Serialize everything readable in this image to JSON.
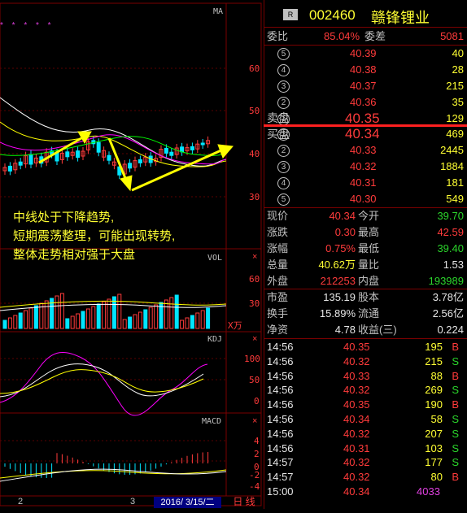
{
  "stock": {
    "badge": "R",
    "code": "002460",
    "name": "赣锋锂业"
  },
  "weibi": {
    "label_ratio": "委比",
    "ratio": "85.04%",
    "label_diff": "委差",
    "diff": "5081"
  },
  "sell_label": "卖盘",
  "buy_label": "买盘",
  "asks": [
    {
      "level": "5",
      "price": "40.39",
      "vol": "40"
    },
    {
      "level": "4",
      "price": "40.38",
      "vol": "28"
    },
    {
      "level": "3",
      "price": "40.37",
      "vol": "215"
    },
    {
      "level": "2",
      "price": "40.36",
      "vol": "35"
    },
    {
      "level": "1",
      "price": "40.35",
      "vol": "129"
    }
  ],
  "bids": [
    {
      "level": "1",
      "price": "40.34",
      "vol": "469"
    },
    {
      "level": "2",
      "price": "40.33",
      "vol": "2445"
    },
    {
      "level": "3",
      "price": "40.32",
      "vol": "1884"
    },
    {
      "level": "4",
      "price": "40.31",
      "vol": "181"
    },
    {
      "level": "5",
      "price": "40.30",
      "vol": "549"
    }
  ],
  "quote": [
    {
      "l1": "现价",
      "v1": "40.34",
      "l2": "今开",
      "v2": "39.70"
    },
    {
      "l1": "涨跌",
      "v1": "0.30",
      "l2": "最高",
      "v2": "42.59"
    },
    {
      "l1": "涨幅",
      "v1": "0.75%",
      "l2": "最低",
      "v2": "39.40"
    },
    {
      "l1": "总量",
      "v1": "40.62万",
      "l2": "量比",
      "v2": "1.53"
    },
    {
      "l1": "外盘",
      "v1": "212253",
      "l2": "内盘",
      "v2": "193989"
    }
  ],
  "fundamentals": [
    {
      "l1": "市盈",
      "v1": "135.19",
      "l2": "股本",
      "v2": "3.78亿"
    },
    {
      "l1": "换手",
      "v1": "15.89%",
      "l2": "流通",
      "v2": "2.56亿"
    },
    {
      "l1": "净资",
      "v1": "4.78",
      "l2": "收益(三)",
      "v2": "0.224"
    }
  ],
  "ticks": [
    {
      "time": "14:56",
      "price": "40.35",
      "vol": "195",
      "side": "B"
    },
    {
      "time": "14:56",
      "price": "40.32",
      "vol": "215",
      "side": "S"
    },
    {
      "time": "14:56",
      "price": "40.33",
      "vol": "88",
      "side": "B"
    },
    {
      "time": "14:56",
      "price": "40.32",
      "vol": "269",
      "side": "S"
    },
    {
      "time": "14:56",
      "price": "40.35",
      "vol": "190",
      "side": "B"
    },
    {
      "time": "14:56",
      "price": "40.34",
      "vol": "58",
      "side": "S"
    },
    {
      "time": "14:56",
      "price": "40.32",
      "vol": "207",
      "side": "S"
    },
    {
      "time": "14:56",
      "price": "40.31",
      "vol": "103",
      "side": "S"
    },
    {
      "time": "14:57",
      "price": "40.32",
      "vol": "177",
      "side": "S"
    },
    {
      "time": "14:57",
      "price": "40.32",
      "vol": "80",
      "side": "B"
    },
    {
      "time": "15:00",
      "price": "40.34",
      "vol": "4033",
      "side": ""
    }
  ],
  "chart": {
    "ma_label": "MA",
    "price_axis": [
      "60",
      "50",
      "40",
      "30"
    ],
    "vol_label": "VOL",
    "vol_axis": [
      "60",
      "30"
    ],
    "vol_unit": "X万",
    "kdj_label": "KDJ",
    "kdj_axis": [
      "100",
      "50",
      "0"
    ],
    "macd_label": "MACD",
    "macd_axis": [
      "4",
      "2",
      "0",
      "-2",
      "-4"
    ],
    "annotation": [
      "中线处于下降趋势,",
      "短期震荡整理，可能出现转势,",
      "整体走势相对强于大盘"
    ],
    "x_labels": [
      "2",
      "3"
    ],
    "date_box": "2016/ 3/15/二",
    "period_label": "日 线",
    "marks": "* * * * *",
    "close_icon": "×"
  }
}
